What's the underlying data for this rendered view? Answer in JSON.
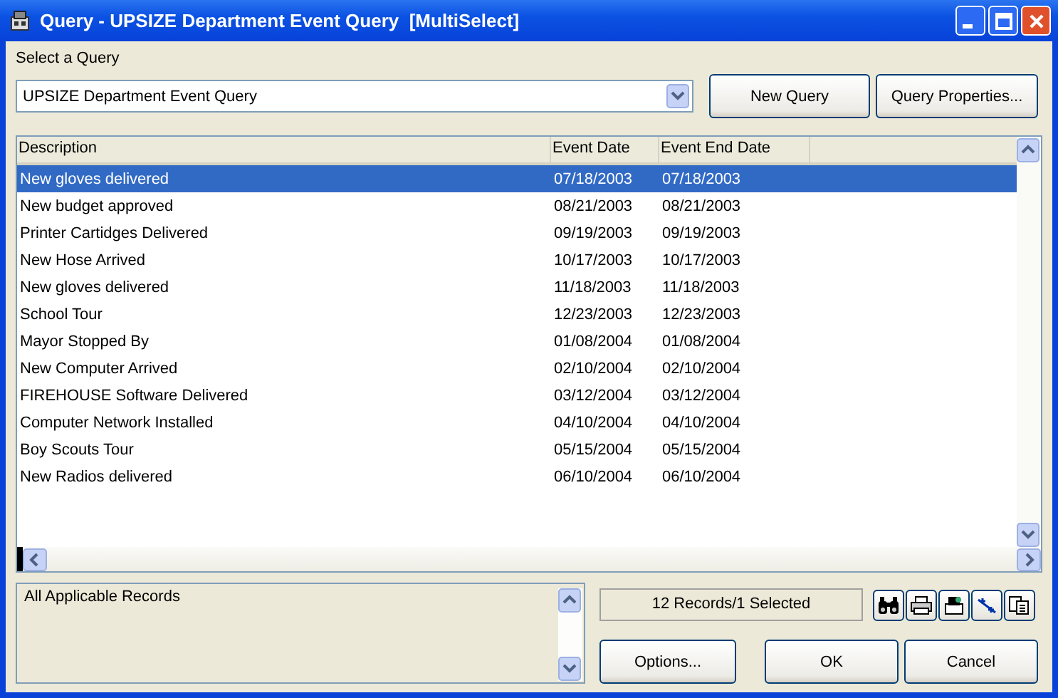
{
  "window": {
    "title": "Query - UPSIZE Department Event Query  [MultiSelect]"
  },
  "query_select": {
    "label": "Select a Query",
    "value": "UPSIZE Department Event Query"
  },
  "top_buttons": [
    "New Query",
    "Query Properties..."
  ],
  "table": {
    "columns": [
      "Description",
      "Event Date",
      "Event End Date"
    ],
    "rows": [
      {
        "cells": [
          "New gloves delivered",
          "07/18/2003",
          "07/18/2003"
        ],
        "selected": true
      },
      {
        "cells": [
          "New budget approved",
          "08/21/2003",
          "08/21/2003"
        ],
        "selected": false
      },
      {
        "cells": [
          "Printer Cartidges Delivered",
          "09/19/2003",
          "09/19/2003"
        ],
        "selected": false
      },
      {
        "cells": [
          "New Hose Arrived",
          "10/17/2003",
          "10/17/2003"
        ],
        "selected": false
      },
      {
        "cells": [
          "New gloves delivered",
          "11/18/2003",
          "11/18/2003"
        ],
        "selected": false
      },
      {
        "cells": [
          "School Tour",
          "12/23/2003",
          "12/23/2003"
        ],
        "selected": false
      },
      {
        "cells": [
          "Mayor Stopped By",
          "01/08/2004",
          "01/08/2004"
        ],
        "selected": false
      },
      {
        "cells": [
          "New Computer Arrived",
          "02/10/2004",
          "02/10/2004"
        ],
        "selected": false
      },
      {
        "cells": [
          "FIREHOUSE Software Delivered",
          "03/12/2004",
          "03/12/2004"
        ],
        "selected": false
      },
      {
        "cells": [
          "Computer Network Installed",
          "04/10/2004",
          "04/10/2004"
        ],
        "selected": false
      },
      {
        "cells": [
          "Boy Scouts Tour",
          "05/15/2004",
          "05/15/2004"
        ],
        "selected": false
      },
      {
        "cells": [
          "New Radios delivered",
          "06/10/2004",
          "06/10/2004"
        ],
        "selected": false
      }
    ]
  },
  "filter_text": "All Applicable Records",
  "status": "12 Records/1 Selected",
  "bottom_buttons": [
    "Options...",
    "OK",
    "Cancel"
  ]
}
